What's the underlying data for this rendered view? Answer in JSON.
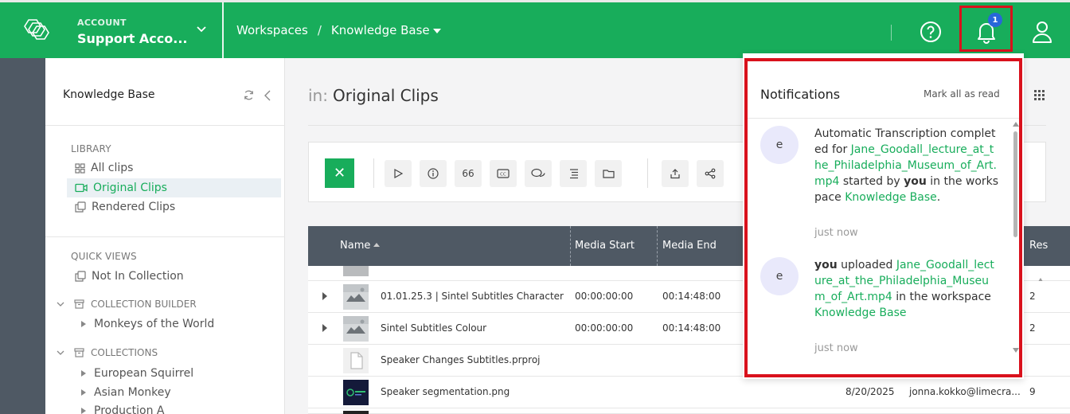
{
  "header": {
    "account_label": "ACCOUNT",
    "account_name": "Support Acco...",
    "breadcrumbs": [
      "Workspaces",
      "Knowledge Base"
    ],
    "breadcrumb_separator": "/",
    "notification_count": "1",
    "brand_color": "#18ad5b"
  },
  "sidebar": {
    "title": "Knowledge Base",
    "library_label": "LIBRARY",
    "library_items": [
      {
        "label": "All clips",
        "icon": "grid-icon"
      },
      {
        "label": "Original Clips",
        "icon": "video-icon",
        "active": true
      },
      {
        "label": "Rendered Clips",
        "icon": "copy-icon"
      }
    ],
    "quick_views_label": "QUICK VIEWS",
    "quick_views": [
      {
        "label": "Not In Collection",
        "icon": "copy-icon"
      }
    ],
    "collection_builder_label": "COLLECTION BUILDER",
    "collection_builder_items": [
      "Monkeys of the World"
    ],
    "collections_label": "COLLECTIONS",
    "collections_items": [
      "European Squirrel",
      "Asian Monkey",
      "Production A"
    ]
  },
  "main": {
    "in_label": "in:",
    "title": "Original Clips",
    "toolbar_buttons": [
      "play-icon",
      "info-icon",
      "66",
      "CC",
      "comments-icon",
      "list-icon",
      "folder-icon",
      "upload-icon",
      "share-icon"
    ]
  },
  "table": {
    "columns": [
      "Name",
      "Media Start",
      "Media End",
      "Res"
    ],
    "rows": [
      {
        "name": "01.01.25.3 | Sintel Subtitles Character",
        "media_start": "00:00:00:00",
        "media_end": "00:14:48:00",
        "date": "",
        "user": "",
        "res": "2",
        "expandable": true,
        "thumb": "video"
      },
      {
        "name": "Sintel Subtitles Colour",
        "media_start": "00:00:00:00",
        "media_end": "00:14:48:00",
        "date": "",
        "user": "",
        "res": "2",
        "expandable": true,
        "thumb": "video"
      },
      {
        "name": "Speaker Changes Subtitles.prproj",
        "media_start": "",
        "media_end": "",
        "date": "",
        "user": "",
        "res": "",
        "expandable": false,
        "thumb": "file"
      },
      {
        "name": "Speaker segmentation.png",
        "media_start": "",
        "media_end": "",
        "date": "8/20/2025",
        "user": "jonna.kokko@limecra...",
        "res": "9",
        "expandable": false,
        "thumb": "image"
      }
    ]
  },
  "notifications": {
    "title": "Notifications",
    "mark_all": "Mark all as read",
    "items": [
      {
        "avatar": "e",
        "text_1": "Automatic Transcription completed for ",
        "file": "Jane_Goodall_lecture_at_the_Philadelphia_Museum_of_Art.mp4",
        "text_2": " started by ",
        "actor": "you",
        "text_3": " in the workspace ",
        "workspace": "Knowledge Base",
        "text_4": ".",
        "time": "just now"
      },
      {
        "avatar": "e",
        "actor": "you",
        "text_1": " uploaded ",
        "file": "Jane_Goodall_lecture_at_the_Philadelphia_Museum_of_Art.mp4",
        "text_2": " in the workspace ",
        "workspace": "Knowledge Base",
        "time": "just now"
      }
    ]
  }
}
